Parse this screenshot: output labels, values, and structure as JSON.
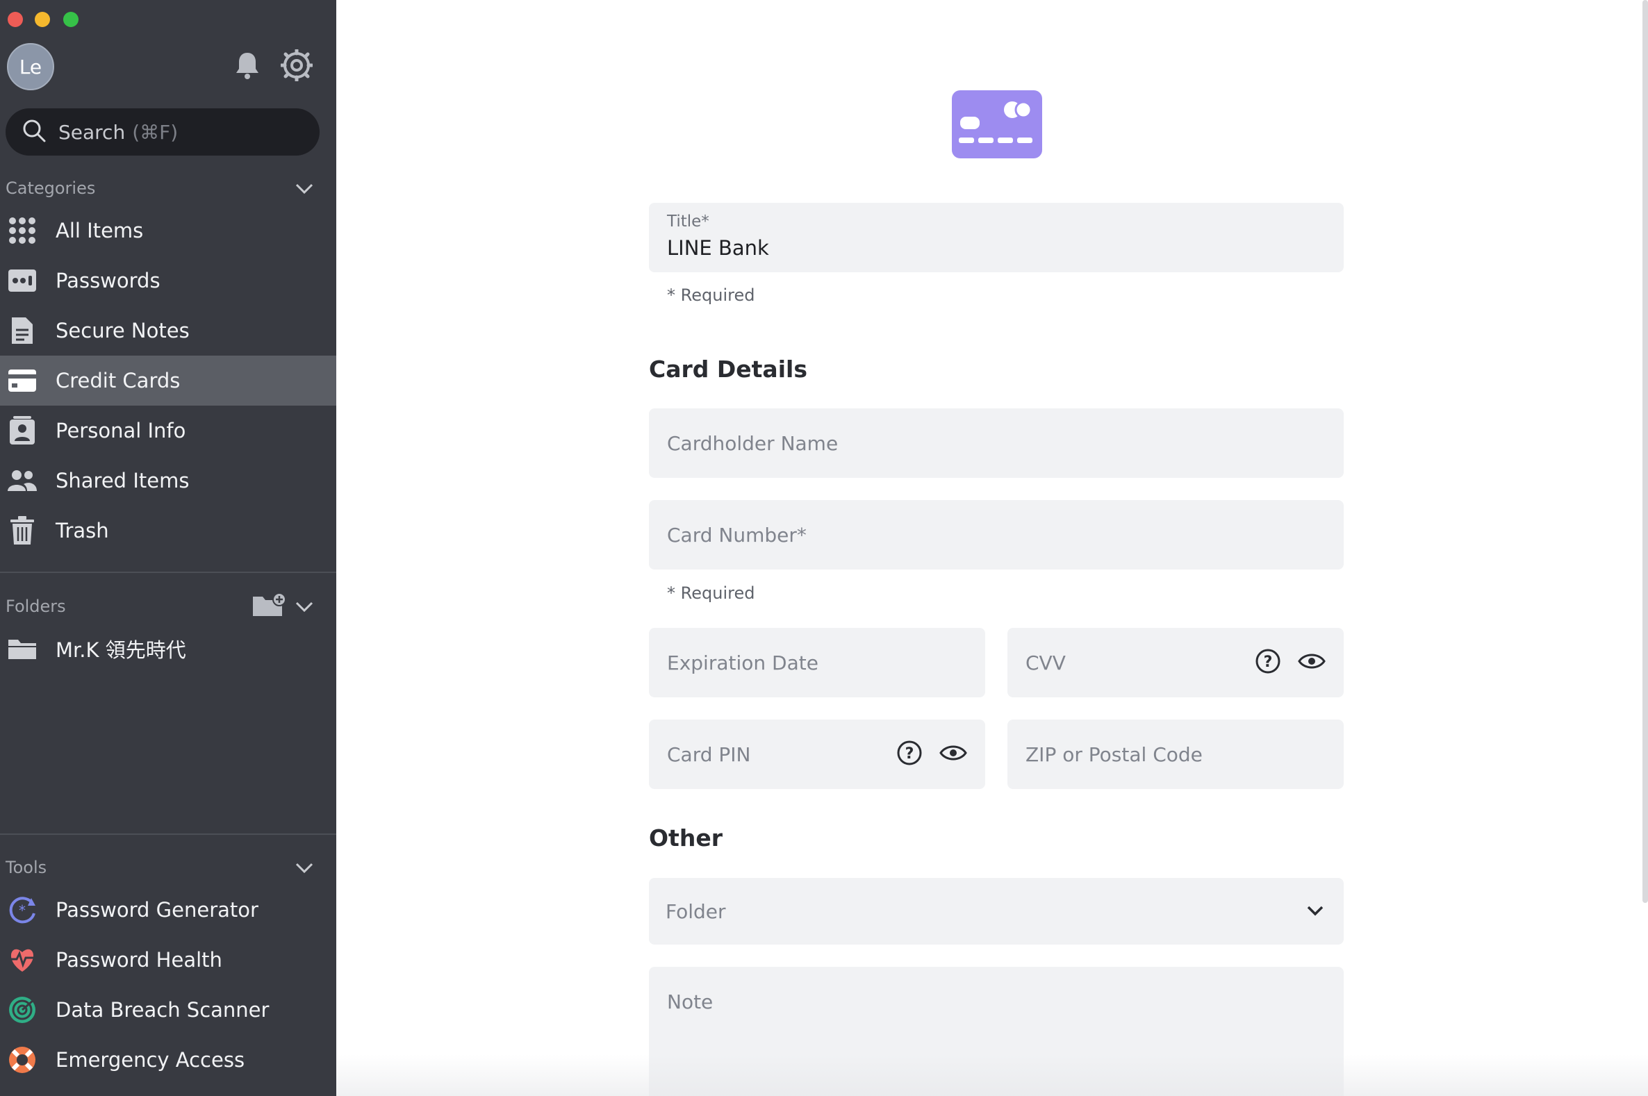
{
  "window": {
    "controls": [
      "close",
      "minimize",
      "zoom"
    ]
  },
  "sidebar": {
    "avatar_initials": "Le",
    "header_icons": [
      "bell-icon",
      "settings-gear-icon"
    ],
    "search": {
      "placeholder": "Search",
      "shortcut": "(⌘F)"
    },
    "categories": {
      "header": "Categories",
      "items": [
        {
          "label": "All Items",
          "icon": "grid-icon"
        },
        {
          "label": "Passwords",
          "icon": "password-card-icon"
        },
        {
          "label": "Secure Notes",
          "icon": "note-icon"
        },
        {
          "label": "Credit Cards",
          "icon": "credit-card-icon",
          "active": true
        },
        {
          "label": "Personal Info",
          "icon": "contact-card-icon"
        },
        {
          "label": "Shared Items",
          "icon": "people-icon"
        },
        {
          "label": "Trash",
          "icon": "trash-icon"
        }
      ]
    },
    "folders": {
      "header": "Folders",
      "items": [
        {
          "label": "Mr.K 領先時代",
          "icon": "folder-icon"
        }
      ]
    },
    "tools": {
      "header": "Tools",
      "items": [
        {
          "label": "Password Generator",
          "icon": "generator-icon"
        },
        {
          "label": "Password Health",
          "icon": "heart-pulse-icon"
        },
        {
          "label": "Data Breach Scanner",
          "icon": "radar-icon"
        },
        {
          "label": "Emergency Access",
          "icon": "lifebuoy-icon"
        }
      ]
    }
  },
  "form": {
    "title_field": {
      "label": "Title*",
      "value": "LINE Bank",
      "help": "* Required"
    },
    "card_details": {
      "heading": "Card Details",
      "cardholder_name": {
        "placeholder": "Cardholder Name"
      },
      "card_number": {
        "placeholder": "Card Number*",
        "help": "* Required"
      },
      "expiration_date": {
        "placeholder": "Expiration Date"
      },
      "cvv": {
        "placeholder": "CVV"
      },
      "card_pin": {
        "placeholder": "Card PIN"
      },
      "zip": {
        "placeholder": "ZIP or Postal Code"
      }
    },
    "other": {
      "heading": "Other",
      "folder": {
        "selected": "Folder"
      },
      "note": {
        "placeholder": "Note"
      }
    }
  },
  "colors": {
    "sidebar_bg": "#383a41",
    "sidebar_active": "#5b5e65",
    "card_icon": "#9d8cf0",
    "field_bg": "#f1f2f4"
  }
}
